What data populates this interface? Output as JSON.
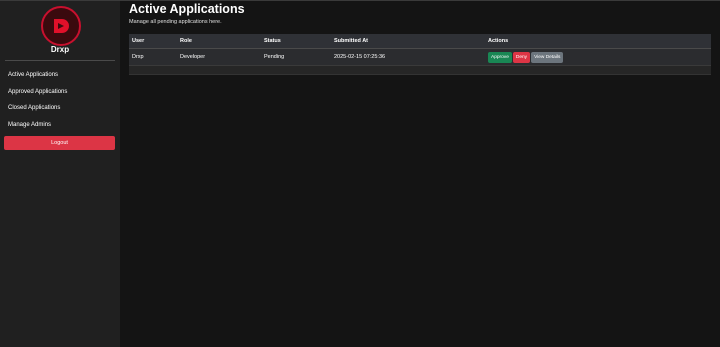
{
  "sidebar": {
    "brand_name": "Drxp",
    "nav_items": [
      {
        "label": "Active Applications"
      },
      {
        "label": "Approved Applications"
      },
      {
        "label": "Closed Applications"
      },
      {
        "label": "Manage Admins"
      }
    ],
    "logout_label": "Logout"
  },
  "main": {
    "title": "Active Applications",
    "subtitle": "Manage all pending applications here.",
    "table": {
      "headers": [
        "User",
        "Role",
        "Status",
        "Submitted At",
        "Actions"
      ],
      "rows": [
        {
          "user": "Drxp",
          "role": "Developer",
          "status": "Pending",
          "submitted_at": "2025-02-15 07:25:36",
          "actions": {
            "approve": "Approve",
            "deny": "Deny",
            "view": "View Details"
          }
        }
      ]
    }
  },
  "colors": {
    "accent_red": "#dc3545",
    "approve_green": "#198754",
    "secondary_gray": "#6c757d",
    "sidebar_bg": "#202020",
    "main_bg": "#141414"
  },
  "icons": {
    "logo": "brand-logo-icon"
  }
}
